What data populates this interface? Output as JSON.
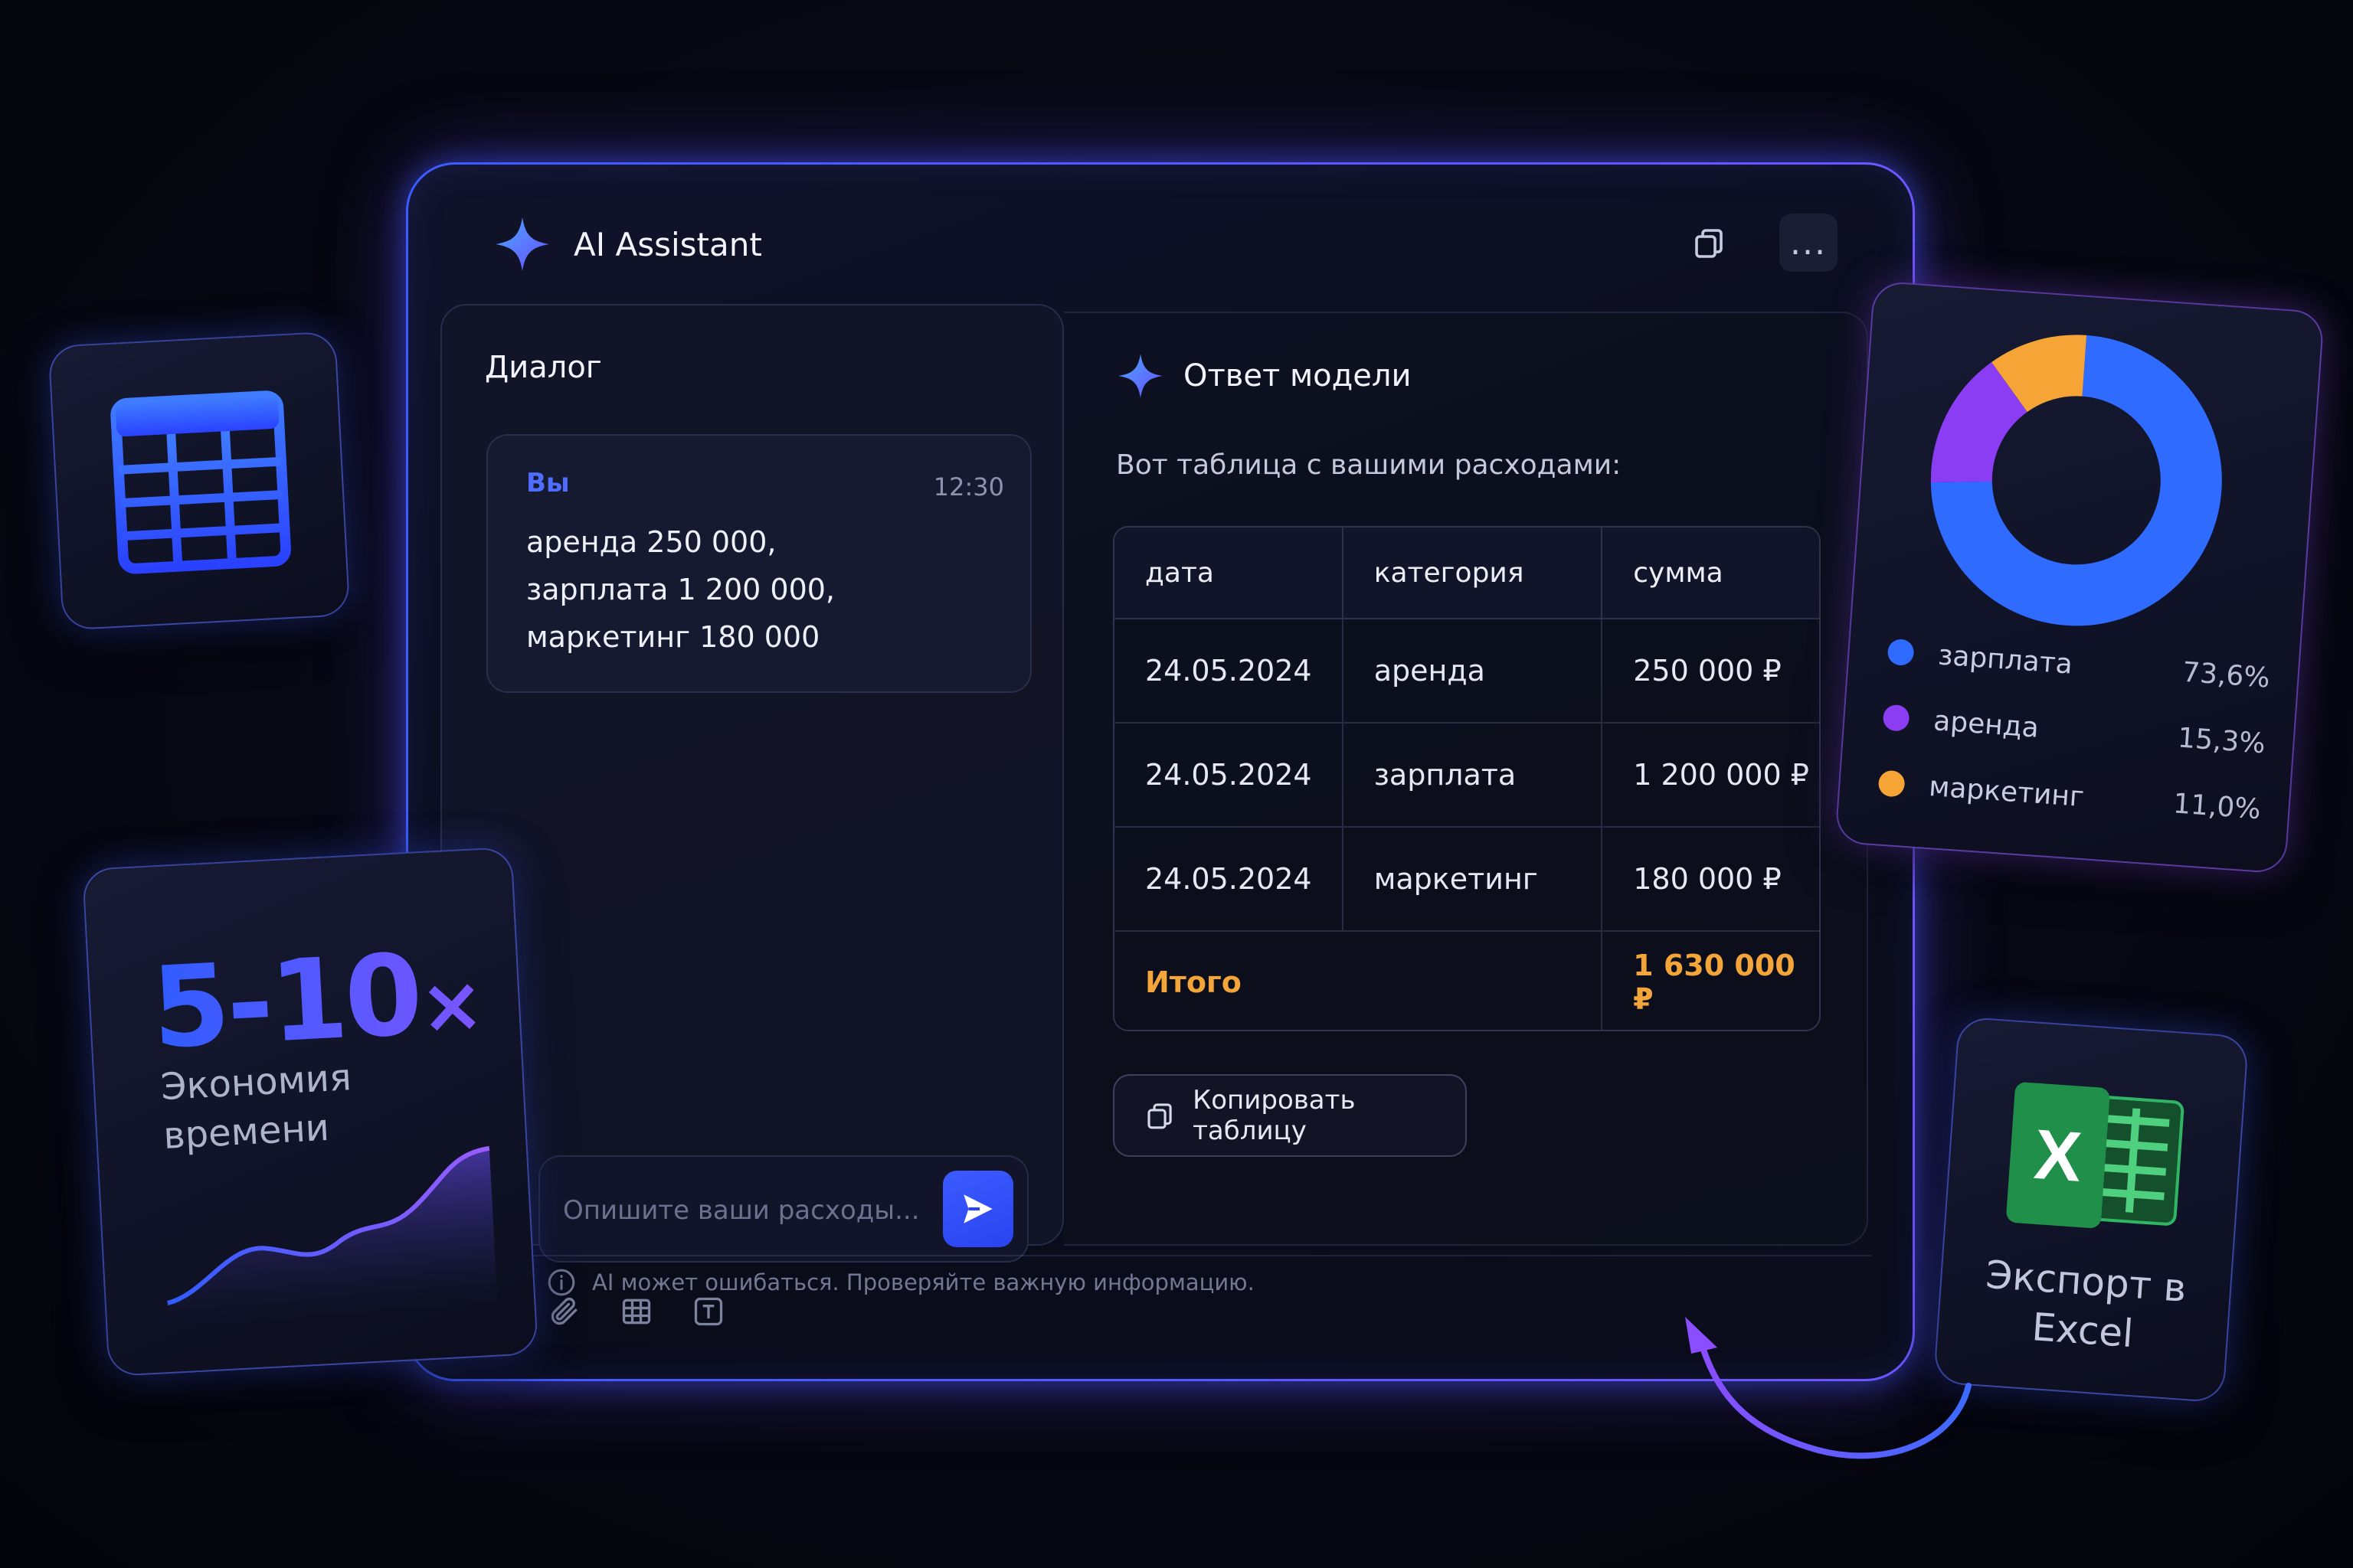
{
  "app": {
    "title": "AI Assistant",
    "copy_icon": "copy-icon",
    "more_icon": "more-icon",
    "more_label": "..."
  },
  "chat": {
    "title": "Диалог",
    "message": {
      "author": "Вы",
      "time": "12:30",
      "lines": [
        "аренда 250 000,",
        "зарплата 1 200 000,",
        "маркетинг 180 000"
      ]
    },
    "input": {
      "placeholder": "Опишите ваши расходы...",
      "value": ""
    },
    "tools": [
      "paperclip-icon",
      "table-icon",
      "text-icon"
    ]
  },
  "response": {
    "title": "Ответ модели",
    "intro": "Вот таблица с вашими расходами:",
    "table": {
      "headers": [
        "дата",
        "категория",
        "сумма"
      ],
      "rows": [
        [
          "24.05.2024",
          "аренда",
          "250 000 ₽"
        ],
        [
          "24.05.2024",
          "зарплата",
          "1 200 000 ₽"
        ],
        [
          "24.05.2024",
          "маркетинг",
          "180 000 ₽"
        ]
      ],
      "total_label": "Итого",
      "total_value": "1 630 000 ₽"
    },
    "copy_button": "Копировать таблицу"
  },
  "footer": {
    "disclaimer": "AI может ошибаться. Проверяйте важную информацию."
  },
  "speed_card": {
    "value": "5-10",
    "suffix": "×",
    "label": "Экономия времени"
  },
  "donut_card": {
    "items": [
      {
        "name": "зарплата",
        "value": "73,6%",
        "share": 73.6,
        "color": "#2f6bff"
      },
      {
        "name": "аренда",
        "value": "15,3%",
        "share": 15.3,
        "color": "#8a3df2"
      },
      {
        "name": "маркетинг",
        "value": "11,0%",
        "share": 11.0,
        "color": "#f7a436"
      }
    ]
  },
  "excel_card": {
    "label": "Экспорт в Excel",
    "badge_letter": "X"
  },
  "colors": {
    "accent": "#3b5bff",
    "total": "#f4a53a",
    "excel": "#1f8f4a"
  }
}
